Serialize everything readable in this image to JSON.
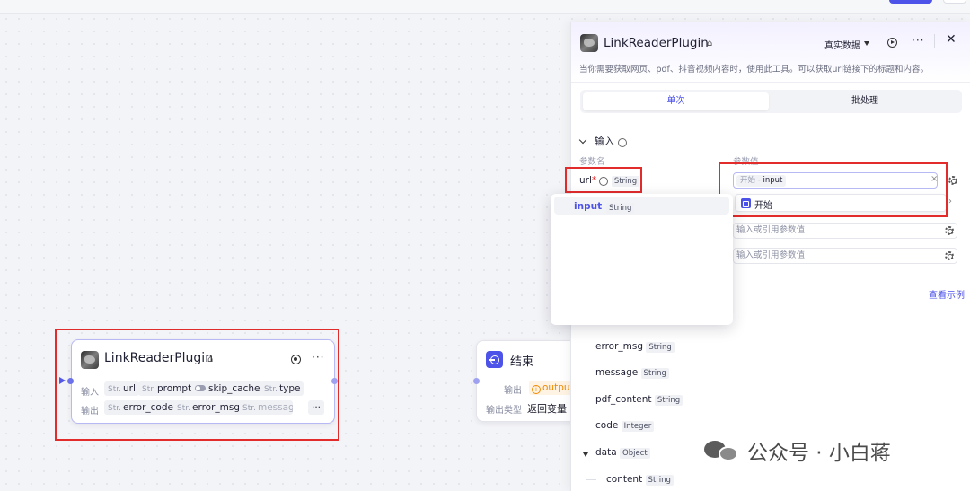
{
  "plugin_node": {
    "title": "LinkReaderPlugin",
    "more": "···",
    "input_label": "输入",
    "output_label": "输出",
    "inputs": [
      {
        "type": "Str.",
        "name": "url"
      },
      {
        "type": "Str.",
        "name": "prompt"
      },
      {
        "type": "",
        "name": "skip_cache"
      },
      {
        "type": "Str.",
        "name": "type"
      }
    ],
    "outputs": [
      {
        "type": "Str.",
        "name": "error_code"
      },
      {
        "type": "Str.",
        "name": "error_msg"
      },
      {
        "type": "Str.",
        "name": "message"
      }
    ],
    "overflow": "···"
  },
  "end_node": {
    "title": "结束",
    "output_label": "输出",
    "output_chip": "output",
    "output_type_label": "输出类型",
    "output_type_value": "返回变量"
  },
  "panel": {
    "title": "LinkReaderPlugin",
    "mode": "真实数据",
    "more": "···",
    "close": "✕",
    "description": "当你需要获取网页、pdf、抖音视频内容时，使用此工具。可以获取url链接下的标题和内容。",
    "tabs": [
      "单次",
      "批处理"
    ],
    "section_title": "输入",
    "col_name": "参数名",
    "col_value": "参数值",
    "url_param": {
      "name": "url",
      "required_mark": "*",
      "type": "String"
    },
    "ref_value": {
      "source": "开始",
      "separator": "-",
      "var": "input"
    },
    "ref_clear": "×",
    "ref_dropdown": {
      "source": "开始",
      "chevron": "›"
    },
    "placeholder": "输入或引用参数值",
    "see_example": "查看示例",
    "outputs": [
      {
        "name": "error_msg",
        "type": "String"
      },
      {
        "name": "message",
        "type": "String"
      },
      {
        "name": "pdf_content",
        "type": "String"
      },
      {
        "name": "code",
        "type": "Integer"
      },
      {
        "name": "data",
        "type": "Object"
      },
      {
        "name": "content",
        "type": "String"
      }
    ]
  },
  "popup": {
    "name": "input",
    "type": "String"
  },
  "watermark": "公众号 · 小白蒋",
  "colors": {
    "accent": "#4d53e8",
    "highlight": "#e22b2b",
    "warn": "#f08a00"
  }
}
